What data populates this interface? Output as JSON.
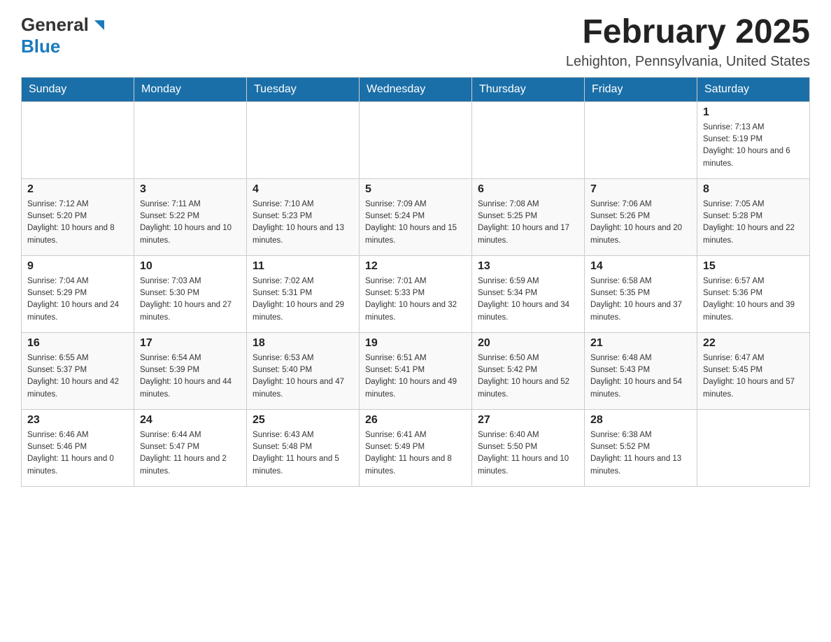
{
  "header": {
    "logo": {
      "general": "General",
      "blue": "Blue",
      "aria": "GeneralBlue logo"
    },
    "month_title": "February 2025",
    "location": "Lehighton, Pennsylvania, United States"
  },
  "days_of_week": [
    "Sunday",
    "Monday",
    "Tuesday",
    "Wednesday",
    "Thursday",
    "Friday",
    "Saturday"
  ],
  "weeks": [
    {
      "days": [
        {
          "number": "",
          "info": ""
        },
        {
          "number": "",
          "info": ""
        },
        {
          "number": "",
          "info": ""
        },
        {
          "number": "",
          "info": ""
        },
        {
          "number": "",
          "info": ""
        },
        {
          "number": "",
          "info": ""
        },
        {
          "number": "1",
          "info": "Sunrise: 7:13 AM\nSunset: 5:19 PM\nDaylight: 10 hours and 6 minutes."
        }
      ]
    },
    {
      "days": [
        {
          "number": "2",
          "info": "Sunrise: 7:12 AM\nSunset: 5:20 PM\nDaylight: 10 hours and 8 minutes."
        },
        {
          "number": "3",
          "info": "Sunrise: 7:11 AM\nSunset: 5:22 PM\nDaylight: 10 hours and 10 minutes."
        },
        {
          "number": "4",
          "info": "Sunrise: 7:10 AM\nSunset: 5:23 PM\nDaylight: 10 hours and 13 minutes."
        },
        {
          "number": "5",
          "info": "Sunrise: 7:09 AM\nSunset: 5:24 PM\nDaylight: 10 hours and 15 minutes."
        },
        {
          "number": "6",
          "info": "Sunrise: 7:08 AM\nSunset: 5:25 PM\nDaylight: 10 hours and 17 minutes."
        },
        {
          "number": "7",
          "info": "Sunrise: 7:06 AM\nSunset: 5:26 PM\nDaylight: 10 hours and 20 minutes."
        },
        {
          "number": "8",
          "info": "Sunrise: 7:05 AM\nSunset: 5:28 PM\nDaylight: 10 hours and 22 minutes."
        }
      ]
    },
    {
      "days": [
        {
          "number": "9",
          "info": "Sunrise: 7:04 AM\nSunset: 5:29 PM\nDaylight: 10 hours and 24 minutes."
        },
        {
          "number": "10",
          "info": "Sunrise: 7:03 AM\nSunset: 5:30 PM\nDaylight: 10 hours and 27 minutes."
        },
        {
          "number": "11",
          "info": "Sunrise: 7:02 AM\nSunset: 5:31 PM\nDaylight: 10 hours and 29 minutes."
        },
        {
          "number": "12",
          "info": "Sunrise: 7:01 AM\nSunset: 5:33 PM\nDaylight: 10 hours and 32 minutes."
        },
        {
          "number": "13",
          "info": "Sunrise: 6:59 AM\nSunset: 5:34 PM\nDaylight: 10 hours and 34 minutes."
        },
        {
          "number": "14",
          "info": "Sunrise: 6:58 AM\nSunset: 5:35 PM\nDaylight: 10 hours and 37 minutes."
        },
        {
          "number": "15",
          "info": "Sunrise: 6:57 AM\nSunset: 5:36 PM\nDaylight: 10 hours and 39 minutes."
        }
      ]
    },
    {
      "days": [
        {
          "number": "16",
          "info": "Sunrise: 6:55 AM\nSunset: 5:37 PM\nDaylight: 10 hours and 42 minutes."
        },
        {
          "number": "17",
          "info": "Sunrise: 6:54 AM\nSunset: 5:39 PM\nDaylight: 10 hours and 44 minutes."
        },
        {
          "number": "18",
          "info": "Sunrise: 6:53 AM\nSunset: 5:40 PM\nDaylight: 10 hours and 47 minutes."
        },
        {
          "number": "19",
          "info": "Sunrise: 6:51 AM\nSunset: 5:41 PM\nDaylight: 10 hours and 49 minutes."
        },
        {
          "number": "20",
          "info": "Sunrise: 6:50 AM\nSunset: 5:42 PM\nDaylight: 10 hours and 52 minutes."
        },
        {
          "number": "21",
          "info": "Sunrise: 6:48 AM\nSunset: 5:43 PM\nDaylight: 10 hours and 54 minutes."
        },
        {
          "number": "22",
          "info": "Sunrise: 6:47 AM\nSunset: 5:45 PM\nDaylight: 10 hours and 57 minutes."
        }
      ]
    },
    {
      "days": [
        {
          "number": "23",
          "info": "Sunrise: 6:46 AM\nSunset: 5:46 PM\nDaylight: 11 hours and 0 minutes."
        },
        {
          "number": "24",
          "info": "Sunrise: 6:44 AM\nSunset: 5:47 PM\nDaylight: 11 hours and 2 minutes."
        },
        {
          "number": "25",
          "info": "Sunrise: 6:43 AM\nSunset: 5:48 PM\nDaylight: 11 hours and 5 minutes."
        },
        {
          "number": "26",
          "info": "Sunrise: 6:41 AM\nSunset: 5:49 PM\nDaylight: 11 hours and 8 minutes."
        },
        {
          "number": "27",
          "info": "Sunrise: 6:40 AM\nSunset: 5:50 PM\nDaylight: 11 hours and 10 minutes."
        },
        {
          "number": "28",
          "info": "Sunrise: 6:38 AM\nSunset: 5:52 PM\nDaylight: 11 hours and 13 minutes."
        },
        {
          "number": "",
          "info": ""
        }
      ]
    }
  ]
}
